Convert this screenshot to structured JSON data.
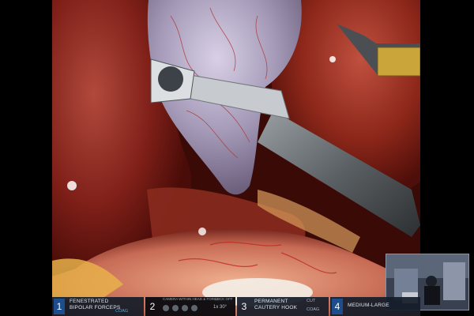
{
  "hud": {
    "slot1": {
      "number": "1",
      "line1": "FENESTRATED",
      "line2": "BIPOLAR FORCEPS",
      "status": "COAG"
    },
    "slot2": {
      "number": "2",
      "top_left": "CAMERA WITHIN HEAD & FORCE",
      "top_right": "LOCK OFF",
      "zoom": "1x 30°"
    },
    "slot3": {
      "number": "3",
      "line1": "PERMANENT",
      "line2": "CAUTERY HOOK",
      "cut": "CUT",
      "coag": "COAG"
    },
    "slot4": {
      "number": "4",
      "line1": "MEDIUM-LARGE"
    }
  },
  "colors": {
    "hud_bg": "#141c28",
    "active_slot": "#1e4d8c",
    "tissue_dark": "#6b1a14",
    "tissue_light": "#a83a2e",
    "gallbladder": "#b9aec9"
  },
  "icons": {
    "camera_controls": "camera-control-icons"
  }
}
